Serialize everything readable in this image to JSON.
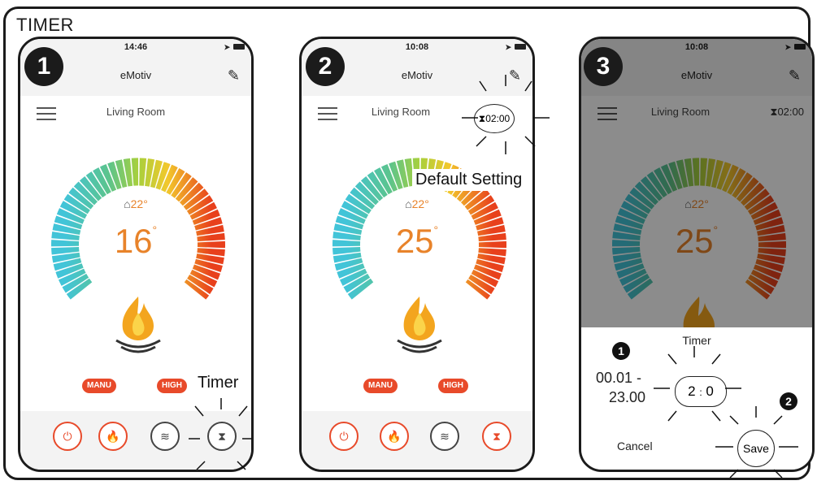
{
  "title": "TIMER",
  "app": {
    "name": "eMotiv",
    "room": "Living Room"
  },
  "phones": [
    {
      "step": "1",
      "time": "14:46",
      "setpoint": "22°",
      "temperature": "16",
      "badge_manu": "MANU",
      "badge_high": "HIGH"
    },
    {
      "step": "2",
      "time": "10:08",
      "setpoint": "22°",
      "temperature": "25",
      "badge_manu": "MANU",
      "badge_high": "HIGH",
      "timer_value": "02:00"
    },
    {
      "step": "3",
      "time": "10:08",
      "setpoint": "22°",
      "temperature": "25",
      "timer_value": "02:00"
    }
  ],
  "callouts": {
    "timer": "Timer",
    "default_setting": "Default Setting"
  },
  "sheet": {
    "title": "Timer",
    "range_line1": "00.01 -",
    "range_line2": "23.00",
    "picker_h": "2",
    "picker_sep": ":",
    "picker_m": "0",
    "cancel": "Cancel",
    "save": "Save",
    "marker1": "1",
    "marker2": "2"
  }
}
